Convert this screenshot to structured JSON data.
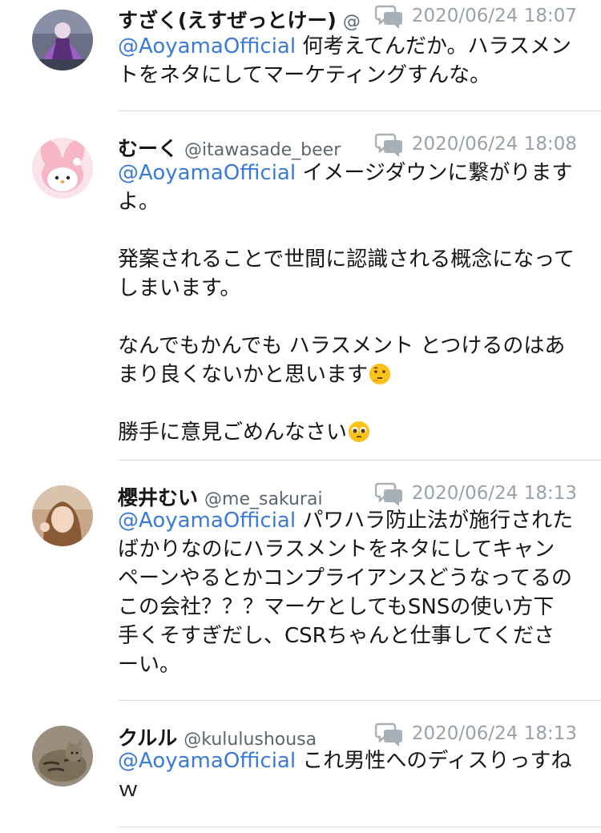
{
  "replies": [
    {
      "name": "すざく(えすぜっとけー)",
      "handle": "@",
      "time": "2020/06/24 18:07",
      "mention": "@AoyamaOfficial",
      "text": " 何考えてんだか。ハラスメントをネタにしてマーケティングすんな。",
      "avatar": "figure-avatar"
    },
    {
      "name": "むーく",
      "handle": "@itawasade_beer",
      "time": "2020/06/24 18:08",
      "mention": "@AoyamaOfficial",
      "text": " イメージダウンに繋がりますよ。",
      "p2": "発案されることで世間に認識される概念になってしまいます。",
      "p3": "なんでもかんでも ハラスメント とつけるのはあまり良くないかと思います",
      "p3_emoji": "thinking-face",
      "p4": "勝手に意見ごめんなさい",
      "p4_emoji": "pleading-face",
      "avatar": "my-melody-avatar"
    },
    {
      "name": "櫻井むい",
      "handle": "@me_sakurai",
      "time": "2020/06/24 18:13",
      "mention": "@AoyamaOfficial",
      "text": " パワハラ防止法が施行されたばかりなのにハラスメントをネタにしてキャンペーンやるとかコンプライアンスどうなってるのこの会社？？？マーケとしてもSNSの使い方下手くそすぎだし、CSRちゃんと仕事してくださーい。",
      "avatar": "woman-avatar"
    },
    {
      "name": "クルル",
      "handle": "@kululushousa",
      "time": "2020/06/24 18:13",
      "mention": "@AoyamaOfficial",
      "text": " これ男性へのディスりっすねｗ",
      "avatar": "cat-avatar"
    }
  ],
  "icons": {
    "reply": "speech-bubbles-icon"
  },
  "colors": {
    "mention": "#3a7bd5",
    "time": "#98a2aa",
    "divider": "#d9dde0"
  }
}
